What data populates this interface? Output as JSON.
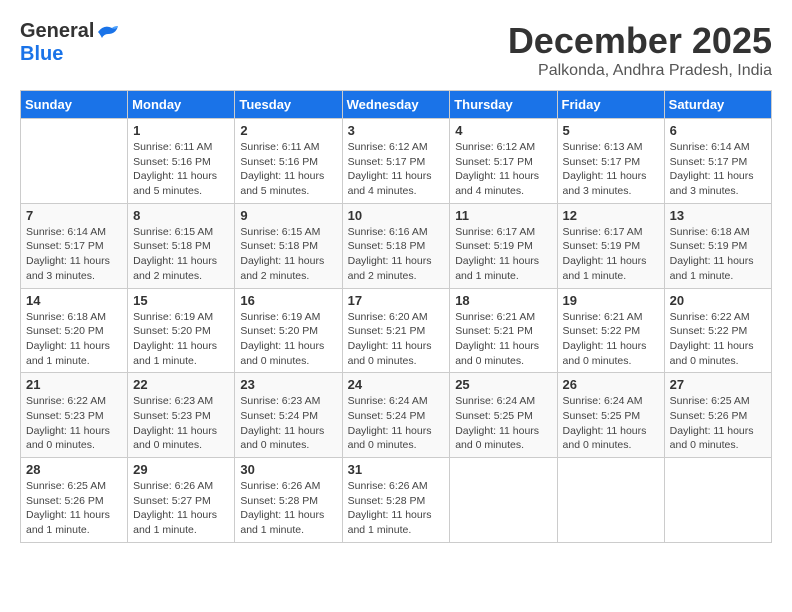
{
  "logo": {
    "general": "General",
    "blue": "Blue"
  },
  "title": {
    "month": "December 2025",
    "location": "Palkonda, Andhra Pradesh, India"
  },
  "headers": [
    "Sunday",
    "Monday",
    "Tuesday",
    "Wednesday",
    "Thursday",
    "Friday",
    "Saturday"
  ],
  "weeks": [
    [
      {
        "day": "",
        "info": ""
      },
      {
        "day": "1",
        "info": "Sunrise: 6:11 AM\nSunset: 5:16 PM\nDaylight: 11 hours\nand 5 minutes."
      },
      {
        "day": "2",
        "info": "Sunrise: 6:11 AM\nSunset: 5:16 PM\nDaylight: 11 hours\nand 5 minutes."
      },
      {
        "day": "3",
        "info": "Sunrise: 6:12 AM\nSunset: 5:17 PM\nDaylight: 11 hours\nand 4 minutes."
      },
      {
        "day": "4",
        "info": "Sunrise: 6:12 AM\nSunset: 5:17 PM\nDaylight: 11 hours\nand 4 minutes."
      },
      {
        "day": "5",
        "info": "Sunrise: 6:13 AM\nSunset: 5:17 PM\nDaylight: 11 hours\nand 3 minutes."
      },
      {
        "day": "6",
        "info": "Sunrise: 6:14 AM\nSunset: 5:17 PM\nDaylight: 11 hours\nand 3 minutes."
      }
    ],
    [
      {
        "day": "7",
        "info": "Sunrise: 6:14 AM\nSunset: 5:17 PM\nDaylight: 11 hours\nand 3 minutes."
      },
      {
        "day": "8",
        "info": "Sunrise: 6:15 AM\nSunset: 5:18 PM\nDaylight: 11 hours\nand 2 minutes."
      },
      {
        "day": "9",
        "info": "Sunrise: 6:15 AM\nSunset: 5:18 PM\nDaylight: 11 hours\nand 2 minutes."
      },
      {
        "day": "10",
        "info": "Sunrise: 6:16 AM\nSunset: 5:18 PM\nDaylight: 11 hours\nand 2 minutes."
      },
      {
        "day": "11",
        "info": "Sunrise: 6:17 AM\nSunset: 5:19 PM\nDaylight: 11 hours\nand 1 minute."
      },
      {
        "day": "12",
        "info": "Sunrise: 6:17 AM\nSunset: 5:19 PM\nDaylight: 11 hours\nand 1 minute."
      },
      {
        "day": "13",
        "info": "Sunrise: 6:18 AM\nSunset: 5:19 PM\nDaylight: 11 hours\nand 1 minute."
      }
    ],
    [
      {
        "day": "14",
        "info": "Sunrise: 6:18 AM\nSunset: 5:20 PM\nDaylight: 11 hours\nand 1 minute."
      },
      {
        "day": "15",
        "info": "Sunrise: 6:19 AM\nSunset: 5:20 PM\nDaylight: 11 hours\nand 1 minute."
      },
      {
        "day": "16",
        "info": "Sunrise: 6:19 AM\nSunset: 5:20 PM\nDaylight: 11 hours\nand 0 minutes."
      },
      {
        "day": "17",
        "info": "Sunrise: 6:20 AM\nSunset: 5:21 PM\nDaylight: 11 hours\nand 0 minutes."
      },
      {
        "day": "18",
        "info": "Sunrise: 6:21 AM\nSunset: 5:21 PM\nDaylight: 11 hours\nand 0 minutes."
      },
      {
        "day": "19",
        "info": "Sunrise: 6:21 AM\nSunset: 5:22 PM\nDaylight: 11 hours\nand 0 minutes."
      },
      {
        "day": "20",
        "info": "Sunrise: 6:22 AM\nSunset: 5:22 PM\nDaylight: 11 hours\nand 0 minutes."
      }
    ],
    [
      {
        "day": "21",
        "info": "Sunrise: 6:22 AM\nSunset: 5:23 PM\nDaylight: 11 hours\nand 0 minutes."
      },
      {
        "day": "22",
        "info": "Sunrise: 6:23 AM\nSunset: 5:23 PM\nDaylight: 11 hours\nand 0 minutes."
      },
      {
        "day": "23",
        "info": "Sunrise: 6:23 AM\nSunset: 5:24 PM\nDaylight: 11 hours\nand 0 minutes."
      },
      {
        "day": "24",
        "info": "Sunrise: 6:24 AM\nSunset: 5:24 PM\nDaylight: 11 hours\nand 0 minutes."
      },
      {
        "day": "25",
        "info": "Sunrise: 6:24 AM\nSunset: 5:25 PM\nDaylight: 11 hours\nand 0 minutes."
      },
      {
        "day": "26",
        "info": "Sunrise: 6:24 AM\nSunset: 5:25 PM\nDaylight: 11 hours\nand 0 minutes."
      },
      {
        "day": "27",
        "info": "Sunrise: 6:25 AM\nSunset: 5:26 PM\nDaylight: 11 hours\nand 0 minutes."
      }
    ],
    [
      {
        "day": "28",
        "info": "Sunrise: 6:25 AM\nSunset: 5:26 PM\nDaylight: 11 hours\nand 1 minute."
      },
      {
        "day": "29",
        "info": "Sunrise: 6:26 AM\nSunset: 5:27 PM\nDaylight: 11 hours\nand 1 minute."
      },
      {
        "day": "30",
        "info": "Sunrise: 6:26 AM\nSunset: 5:28 PM\nDaylight: 11 hours\nand 1 minute."
      },
      {
        "day": "31",
        "info": "Sunrise: 6:26 AM\nSunset: 5:28 PM\nDaylight: 11 hours\nand 1 minute."
      },
      {
        "day": "",
        "info": ""
      },
      {
        "day": "",
        "info": ""
      },
      {
        "day": "",
        "info": ""
      }
    ]
  ]
}
